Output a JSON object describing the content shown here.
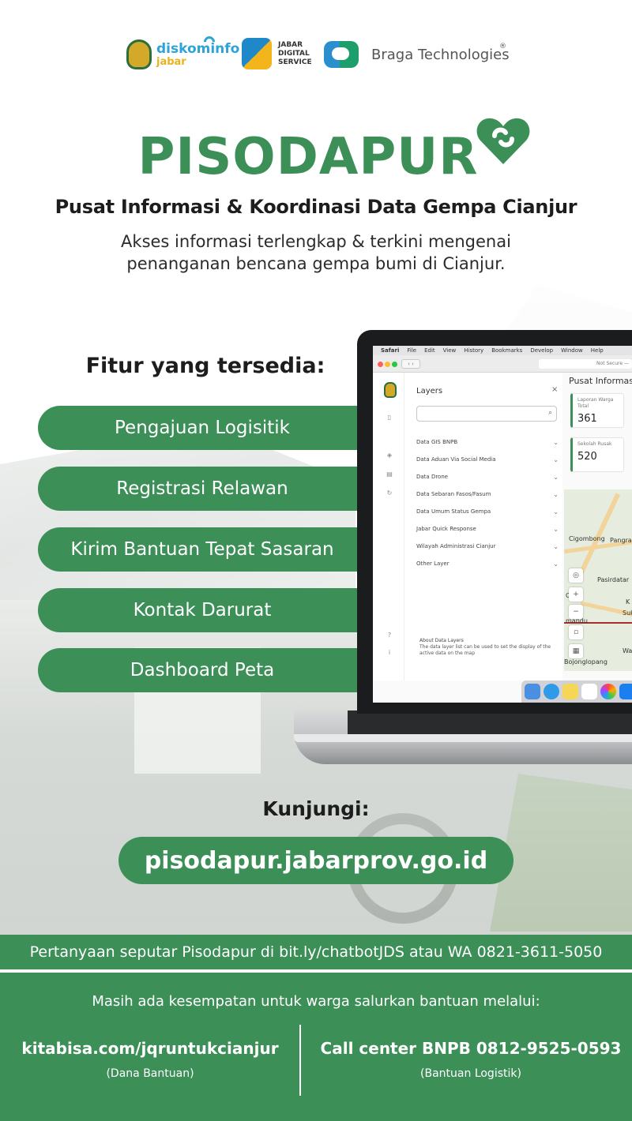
{
  "logos": {
    "diskominfo_name": "diskominfo",
    "diskominfo_sub": "jabar",
    "jds_text": [
      "JABAR",
      "DIGITAL",
      "SERVICE"
    ],
    "braga_name": "Braga Technologies",
    "braga_mark": "®"
  },
  "hero": {
    "title": "PISODAPUR",
    "subtitle": "Pusat Informasi & Koordinasi Data Gempa Cianjur",
    "description_lines": [
      "Akses informasi terlengkap & terkini mengenai",
      "penanganan bencana gempa bumi di Cianjur."
    ]
  },
  "features": {
    "heading": "Fitur yang tersedia:",
    "items": [
      "Pengajuan Logisitik",
      "Registrasi Relawan",
      "Kirim Bantuan Tepat Sasaran",
      "Kontak Darurat",
      "Dashboard Peta"
    ]
  },
  "laptop": {
    "menubar": [
      "Safari",
      "File",
      "Edit",
      "View",
      "History",
      "Bookmarks",
      "Develop",
      "Window",
      "Help"
    ],
    "url_text": "Not Secure —",
    "layers": {
      "title": "Layers",
      "close": "×",
      "items": [
        "Data GIS BNPB",
        "Data Aduan Via Social Media",
        "Data Drone",
        "Data Sebaran Fasos/Fasum",
        "Data Umum Status Gempa",
        "Jabar Quick Response",
        "Wilayah Administrasi Cianjur",
        "Other Layer"
      ],
      "about_title": "About Data Layers",
      "about_desc": "The data layer list can be used to set the display of the active data on the map"
    },
    "info_title": "Pusat Informasi",
    "stats": [
      {
        "label": "Laporan Warga Total",
        "value": "361"
      },
      {
        "label": "Sekolah Rusak",
        "value": "520"
      }
    ],
    "map_labels": [
      "Cigombong",
      "Pangra",
      "Pasirdatar",
      "Ci",
      "K",
      "Suk",
      "mandu",
      "Wa",
      "Bojonglopang"
    ]
  },
  "visit": {
    "label": "Kunjungi:",
    "url": "pisodapur.jabarprov.go.id"
  },
  "faq": "Pertanyaan seputar Pisodapur di bit.ly/chatbotJDS atau WA 0821-3611-5050",
  "footer": {
    "intro": "Masih ada kesempatan untuk warga salurkan bantuan melalui:",
    "left_main": "kitabisa.com/jqruntukcianjur",
    "left_sub": "(Dana Bantuan)",
    "right_main": "Call center BNPB 0812-9525-0593",
    "right_sub": "(Bantuan Logistik)"
  },
  "colors": {
    "brand_green": "#3d8f58",
    "text_dark": "#1d1d1d"
  }
}
